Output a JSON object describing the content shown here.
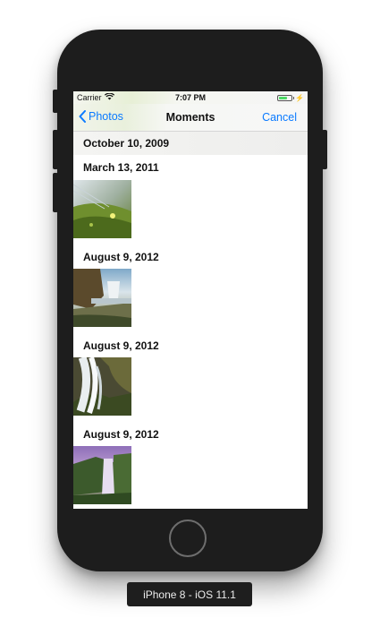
{
  "status_bar": {
    "carrier": "Carrier",
    "time": "7:07 PM"
  },
  "nav": {
    "back_label": "Photos",
    "title": "Moments",
    "cancel_label": "Cancel"
  },
  "sticky_header": "October 10, 2009",
  "sections": [
    {
      "date": "March 13, 2011"
    },
    {
      "date": "August 9, 2012"
    },
    {
      "date": "August 9, 2012"
    },
    {
      "date": "August 9, 2012"
    }
  ],
  "device_label": "iPhone 8 - iOS 11.1"
}
